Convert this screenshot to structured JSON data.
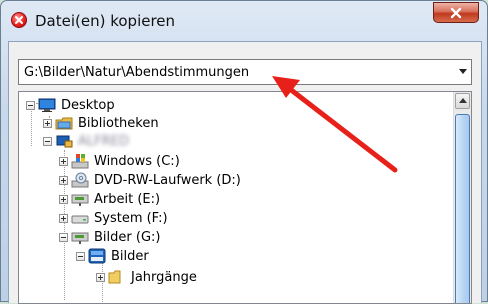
{
  "window": {
    "title": "Datei(en) kopieren",
    "close_icon": "close-icon",
    "app_icon": "copy-cancel-icon"
  },
  "path": {
    "value": "G:\\Bilder\\Natur\\Abendstimmungen"
  },
  "tree": {
    "nodes": [
      {
        "label": "Desktop",
        "icon": "desktop-icon",
        "state": "expanded"
      },
      {
        "label": "Bibliotheken",
        "icon": "libraries-icon",
        "state": "collapsed"
      },
      {
        "label": "ALFRED",
        "icon": "user-icon",
        "state": "expanded",
        "blurred": true
      },
      {
        "label": "Windows (C:)",
        "icon": "windows-drive-icon",
        "state": "collapsed"
      },
      {
        "label": "DVD-RW-Laufwerk (D:)",
        "icon": "dvd-drive-icon",
        "state": "collapsed"
      },
      {
        "label": "Arbeit (E:)",
        "icon": "network-drive-icon",
        "state": "collapsed"
      },
      {
        "label": "System (F:)",
        "icon": "hard-drive-icon",
        "state": "collapsed"
      },
      {
        "label": "Bilder (G:)",
        "icon": "network-drive-icon",
        "state": "expanded"
      },
      {
        "label": "Bilder",
        "icon": "folder-pictures-icon",
        "state": "expanded"
      },
      {
        "label": "Jahrgänge",
        "icon": "folder-icon",
        "state": "collapsed"
      }
    ]
  },
  "colors": {
    "annotation_arrow": "#e8201a",
    "selection_thumb": "#b5d4f3"
  }
}
